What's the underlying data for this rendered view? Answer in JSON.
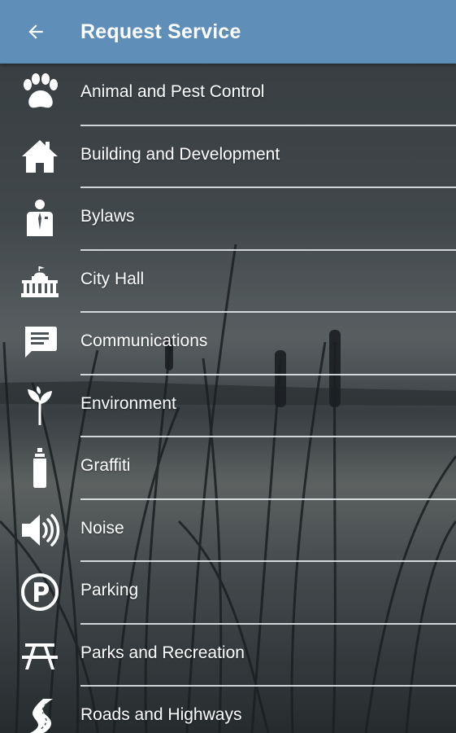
{
  "colors": {
    "appbar": "#5f8fb8",
    "text": "#ffffff",
    "divider": "#e6ecef"
  },
  "header": {
    "back_icon": "arrow-left-icon",
    "title": "Request Service"
  },
  "services": [
    {
      "label": "Animal and Pest Control",
      "icon": "paw-icon"
    },
    {
      "label": "Building and Development",
      "icon": "house-icon"
    },
    {
      "label": "Bylaws",
      "icon": "officer-icon"
    },
    {
      "label": "City Hall",
      "icon": "city-hall-icon"
    },
    {
      "label": "Communications",
      "icon": "speech-bubble-icon"
    },
    {
      "label": "Environment",
      "icon": "sprout-icon"
    },
    {
      "label": "Graffiti",
      "icon": "spray-can-icon"
    },
    {
      "label": "Noise",
      "icon": "speaker-icon"
    },
    {
      "label": "Parking",
      "icon": "parking-icon"
    },
    {
      "label": "Parks and Recreation",
      "icon": "picnic-table-icon"
    },
    {
      "label": "Roads and Highways",
      "icon": "road-icon"
    }
  ]
}
